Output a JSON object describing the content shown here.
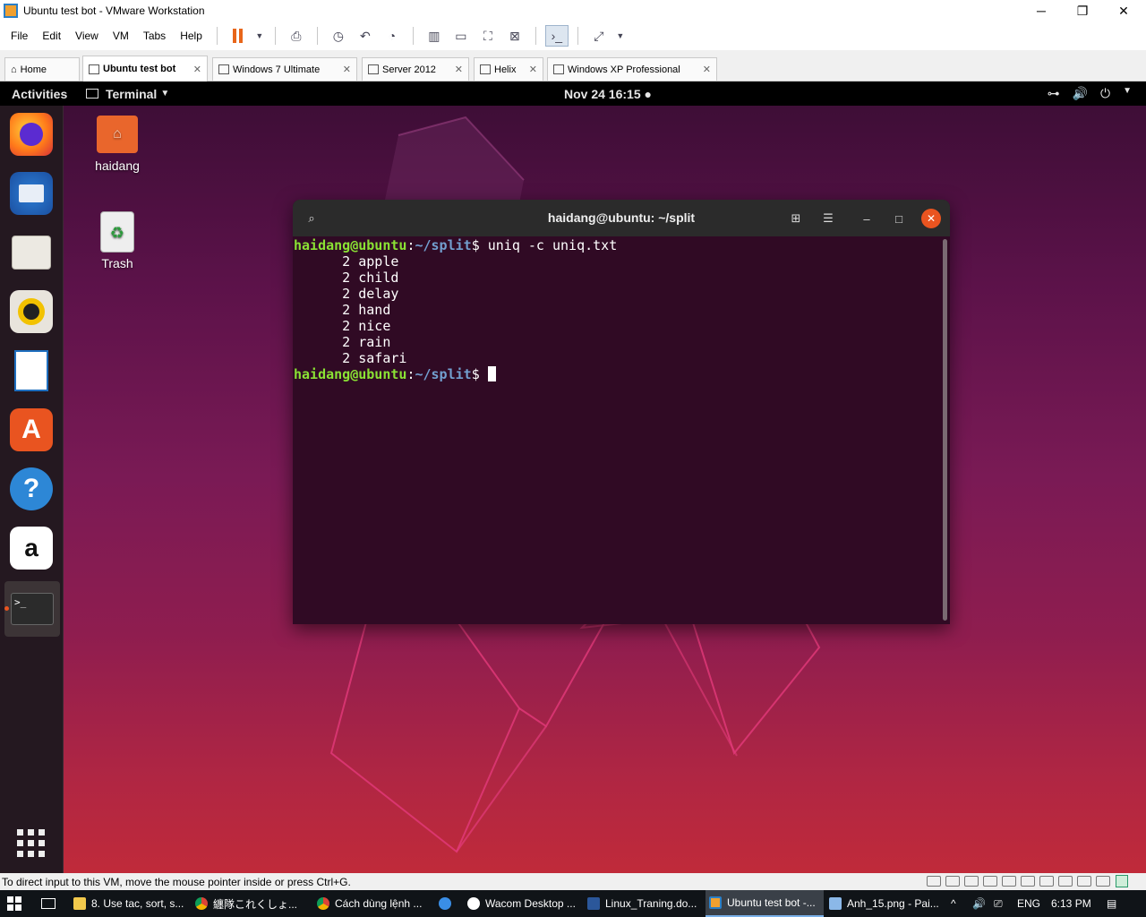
{
  "window": {
    "title": "Ubuntu test bot - VMware Workstation",
    "controls": {
      "minimize": "─",
      "restore": "❐",
      "close": "✕"
    }
  },
  "menu": [
    "File",
    "Edit",
    "View",
    "VM",
    "Tabs",
    "Help"
  ],
  "tabs": [
    {
      "label": "Home",
      "closable": false
    },
    {
      "label": "Ubuntu test bot",
      "closable": true,
      "active": true
    },
    {
      "label": "Windows 7 Ultimate",
      "closable": true
    },
    {
      "label": "Server 2012",
      "closable": true
    },
    {
      "label": "Helix",
      "closable": true
    },
    {
      "label": "Windows XP Professional",
      "closable": true
    }
  ],
  "gnome": {
    "activities": "Activities",
    "app_menu": "Terminal",
    "clock": "Nov 24  16:15 ●"
  },
  "desktop": {
    "home_label": "haidang",
    "trash_label": "Trash"
  },
  "terminal": {
    "title": "haidang@ubuntu: ~/split",
    "prompt_user": "haidang@ubuntu",
    "prompt_sep": ":",
    "prompt_path": "~/split",
    "prompt_end": "$ ",
    "command": "uniq -c uniq.txt",
    "output": [
      "      2 apple",
      "      2 child",
      "      2 delay",
      "      2 hand",
      "      2 nice",
      "      2 rain",
      "      2 safari"
    ]
  },
  "status": {
    "message": "To direct input to this VM, move the mouse pointer inside or press Ctrl+G."
  },
  "taskbar": {
    "items": [
      "8. Use tac, sort, s...",
      "纏隊これくしょ...",
      "Cách dùng lệnh ...",
      "Wacom Desktop ...",
      "Linux_Traning.do...",
      "Ubuntu test bot -...",
      "Anh_15.png - Pai..."
    ],
    "lang": "ENG",
    "time": "6:13 PM"
  }
}
